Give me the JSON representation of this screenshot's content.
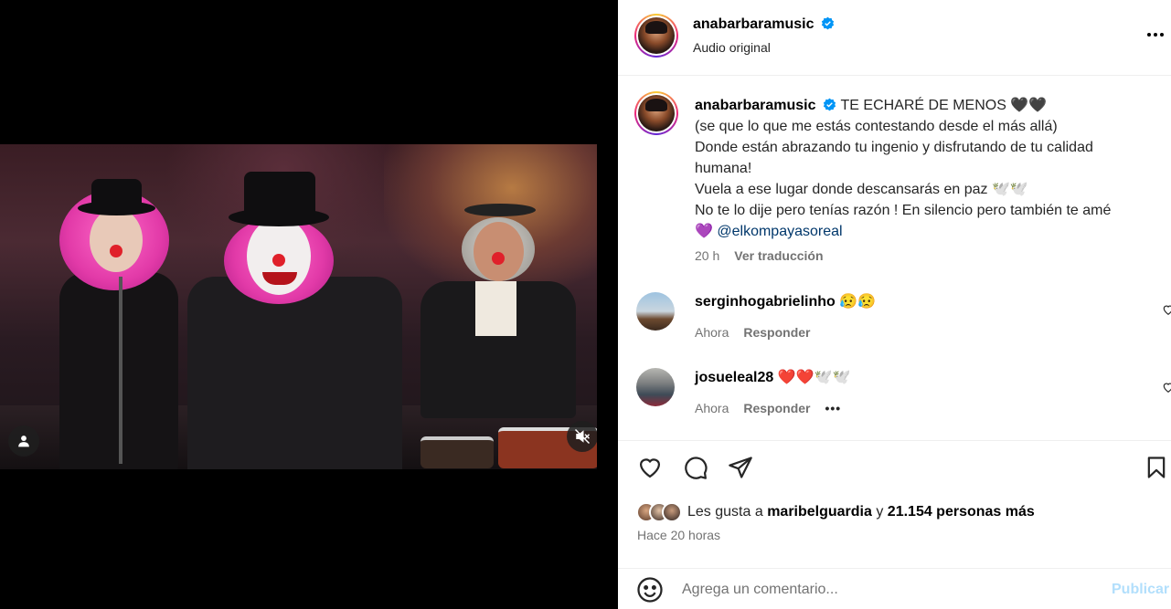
{
  "post": {
    "author": "anabarbaramusic",
    "audio": "Audio original",
    "caption_title": "TE ECHARÉ DE MENOS 🖤🖤",
    "caption_lines": [
      "(se que lo que me estás contestando desde el más allá)",
      "Donde están abrazando tu ingenio y disfrutando de tu calidad",
      "humana!",
      "Vuela a ese lugar donde descansarás en paz 🕊️🕊️",
      "No te lo dije pero tenías razón ! En silencio pero también te amé"
    ],
    "mention_prefix": "💜",
    "mention": "@elkompayasoreal",
    "age": "20 h",
    "translate": "Ver traducción"
  },
  "comments": [
    {
      "user": "serginhogabrielinho",
      "text": "😥😥",
      "time": "Ahora",
      "reply": "Responder"
    },
    {
      "user": "josueleal28",
      "text": "❤️❤️🕊️🕊️",
      "time": "Ahora",
      "reply": "Responder",
      "more": "•••"
    }
  ],
  "likes": {
    "prefix": "Les gusta a",
    "user": "maribelguardia",
    "middle": "y",
    "others": "21.154 personas más"
  },
  "posted": "Hace 20 horas",
  "comment_box": {
    "placeholder": "Agrega un comentario...",
    "post_label": "Publicar"
  },
  "colors": {
    "verified": "#0095f6",
    "post_button_disabled": "#b2dffc",
    "link": "#00376b"
  }
}
